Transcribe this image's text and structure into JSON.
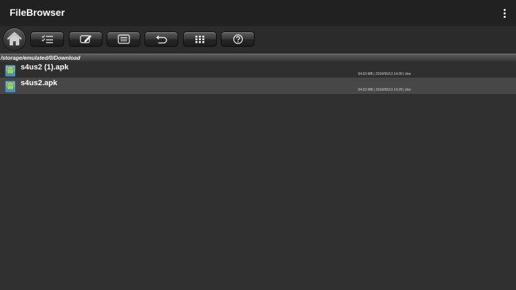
{
  "app": {
    "title": "FileBrowser"
  },
  "toolbar": {
    "buttons": [
      {
        "icon": "home-icon"
      },
      {
        "icon": "checklist-icon"
      },
      {
        "icon": "rename-icon"
      },
      {
        "icon": "list-icon"
      },
      {
        "icon": "undo-icon"
      },
      {
        "icon": "grid-icon"
      },
      {
        "icon": "help-icon"
      }
    ]
  },
  "path": "/storage/emulated/0/Download",
  "files": [
    {
      "name": "s4us2 (1).apk",
      "size": "64.63 MB",
      "date": "2019/06/13 14:30",
      "perms": "drw",
      "meta": "64.63 MB | 2019/06/13 14:30 | drw",
      "selected": false
    },
    {
      "name": "s4us2.apk",
      "size": "64.63 MB",
      "date": "2019/06/13 14:28",
      "perms": "drw",
      "meta": "64.63 MB | 2019/06/13 14:28 | drw",
      "selected": true
    }
  ]
}
